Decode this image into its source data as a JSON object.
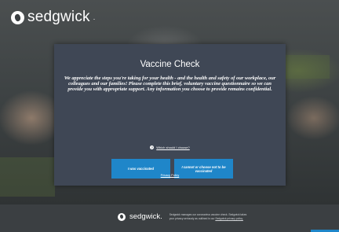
{
  "header": {
    "brand": "sedgwick",
    "brand_mark": "."
  },
  "modal": {
    "title": "Vaccine Check",
    "intro": "We appreciate the steps you're taking for your health - and the health and safety of our workplace, our colleagues and our families! Please complete this brief, voluntary vaccine questionnaire so we can provide you with appropriate support. Any information you choose to provide remains confidential.",
    "help_icon": "question-circle-icon",
    "help_link": "Which should I choose?",
    "button_vaccinated": "I was vaccinated",
    "button_not_vaccinated": "I cannot or choose not to be vaccinated",
    "privacy_link": "Privacy Policy"
  },
  "footer": {
    "brand": "sedgwick.",
    "note_prefix": "Sedgwick manages our coronavirus vaccine check. Sedgwick takes your privacy seriously as outlined in our",
    "note_link": "Sedgwick privacy policy."
  },
  "colors": {
    "accent": "#1f86c9",
    "modal_bg": "#3f4755",
    "footer_bg": "#3b3f42"
  }
}
